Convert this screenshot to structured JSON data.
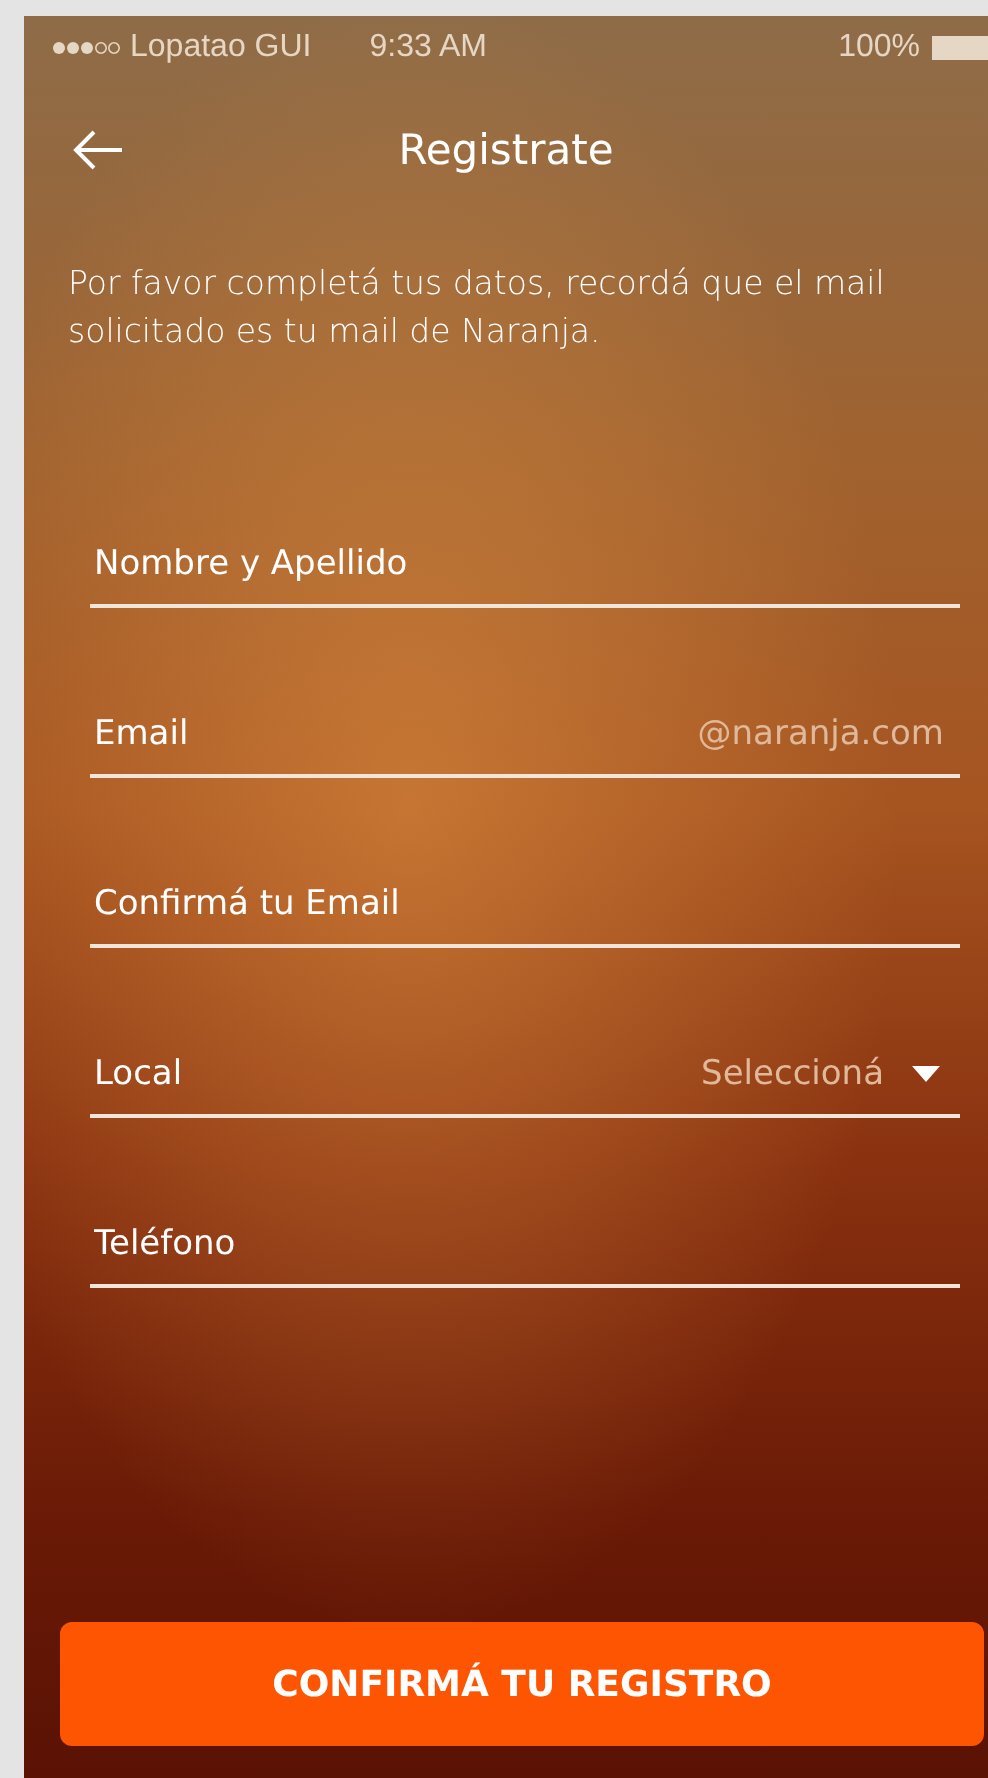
{
  "status_bar": {
    "carrier": "Lopatao GUI",
    "time": "9:33 AM",
    "battery": "100%"
  },
  "header": {
    "title": "Registrate"
  },
  "intro": "Por favor completá tus datos, recordá que el mail solicitado es tu mail de Naranja.",
  "fields": [
    {
      "kind": "text",
      "placeholder": "Nombre y Apellido"
    },
    {
      "kind": "text",
      "placeholder": "Email",
      "suffix": "@naranja.com"
    },
    {
      "kind": "text",
      "placeholder": "Confirmá tu Email"
    },
    {
      "kind": "select",
      "label": "Local",
      "placeholder": "Seleccioná"
    },
    {
      "kind": "text",
      "placeholder": "Teléfono"
    }
  ],
  "submit": "CONFIRMÁ TU REGISTRO"
}
